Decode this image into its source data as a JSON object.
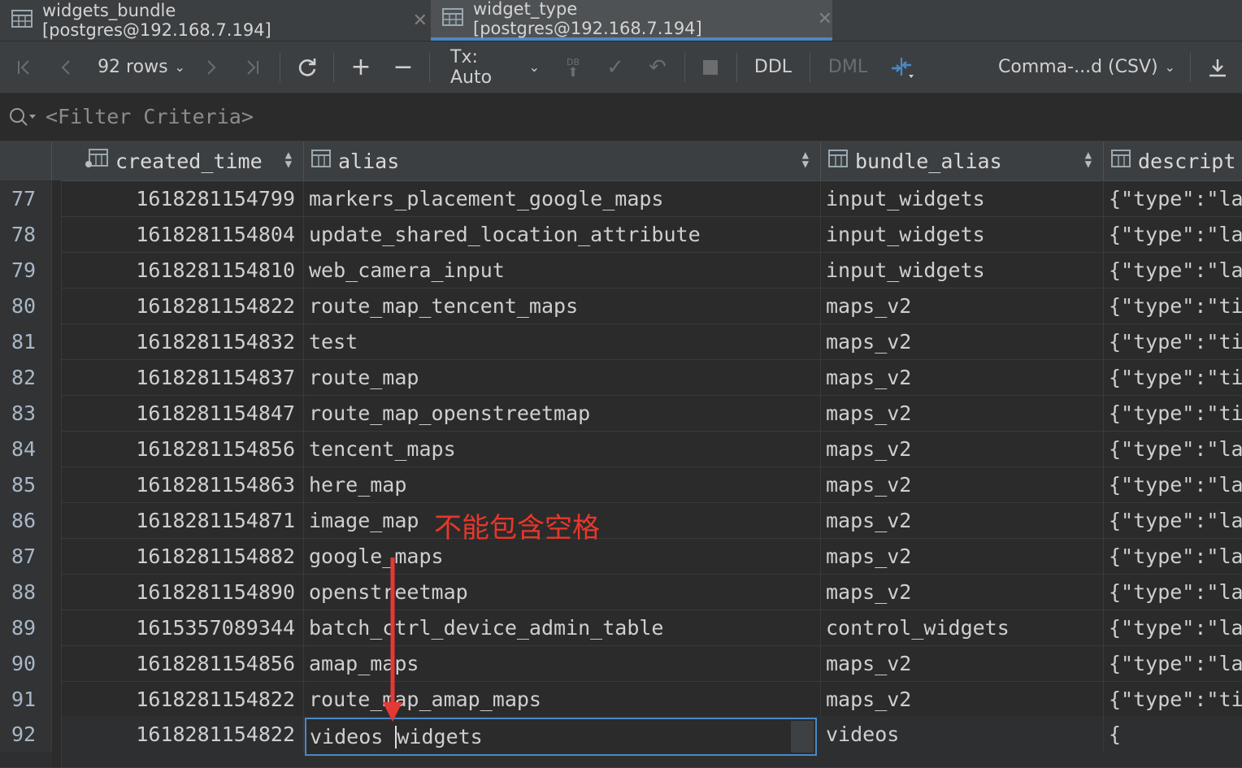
{
  "tabs": [
    {
      "label": "widgets_bundle [postgres@192.168.7.194]",
      "active": false
    },
    {
      "label": "widget_type [postgres@192.168.7.194]",
      "active": true
    }
  ],
  "toolbar": {
    "rows_label": "92 rows",
    "tx_label": "Tx: Auto",
    "db_badge": "DB",
    "ddl_label": "DDL",
    "dml_label": "DML",
    "export_format": "Comma-...d (CSV)"
  },
  "filter": {
    "placeholder": "<Filter Criteria>"
  },
  "columns": [
    "created_time",
    "alias",
    "bundle_alias",
    "descript"
  ],
  "rows": [
    {
      "n": "77",
      "time": "1618281154799",
      "alias": "markers_placement_google_maps",
      "bundle": "input_widgets",
      "desc": "{\"type\":\"la"
    },
    {
      "n": "78",
      "time": "1618281154804",
      "alias": "update_shared_location_attribute",
      "bundle": "input_widgets",
      "desc": "{\"type\":\"la"
    },
    {
      "n": "79",
      "time": "1618281154810",
      "alias": "web_camera_input",
      "bundle": "input_widgets",
      "desc": "{\"type\":\"la"
    },
    {
      "n": "80",
      "time": "1618281154822",
      "alias": "route_map_tencent_maps",
      "bundle": "maps_v2",
      "desc": "{\"type\":\"ti"
    },
    {
      "n": "81",
      "time": "1618281154832",
      "alias": "test",
      "bundle": "maps_v2",
      "desc": "{\"type\":\"ti"
    },
    {
      "n": "82",
      "time": "1618281154837",
      "alias": "route_map",
      "bundle": "maps_v2",
      "desc": "{\"type\":\"ti"
    },
    {
      "n": "83",
      "time": "1618281154847",
      "alias": "route_map_openstreetmap",
      "bundle": "maps_v2",
      "desc": "{\"type\":\"ti"
    },
    {
      "n": "84",
      "time": "1618281154856",
      "alias": "tencent_maps",
      "bundle": "maps_v2",
      "desc": "{\"type\":\"la"
    },
    {
      "n": "85",
      "time": "1618281154863",
      "alias": "here_map",
      "bundle": "maps_v2",
      "desc": "{\"type\":\"la"
    },
    {
      "n": "86",
      "time": "1618281154871",
      "alias": "image_map",
      "bundle": "maps_v2",
      "desc": "{\"type\":\"la"
    },
    {
      "n": "87",
      "time": "1618281154882",
      "alias": "google_maps",
      "bundle": "maps_v2",
      "desc": "{\"type\":\"la"
    },
    {
      "n": "88",
      "time": "1618281154890",
      "alias": "openstreetmap",
      "bundle": "maps_v2",
      "desc": "{\"type\":\"la"
    },
    {
      "n": "89",
      "time": "1615357089344",
      "alias": "batch_ctrl_device_admin_table",
      "bundle": "control_widgets",
      "desc": "{\"type\":\"la"
    },
    {
      "n": "90",
      "time": "1618281154856",
      "alias": "amap_maps",
      "bundle": "maps_v2",
      "desc": "{\"type\":\"la"
    },
    {
      "n": "91",
      "time": "1618281154822",
      "alias": "route_map_amap_maps",
      "bundle": "maps_v2",
      "desc": "{\"type\":\"ti"
    }
  ],
  "editing_row": {
    "n": "92",
    "time": "1618281154822",
    "alias_before_caret": "videos ",
    "alias_after_caret": "widgets",
    "bundle": "videos",
    "desc": "{"
  },
  "annotation": "不能包含空格",
  "colors": {
    "accent": "#4a88c7",
    "annotation": "#e8372b",
    "arrow": "#e53935"
  }
}
